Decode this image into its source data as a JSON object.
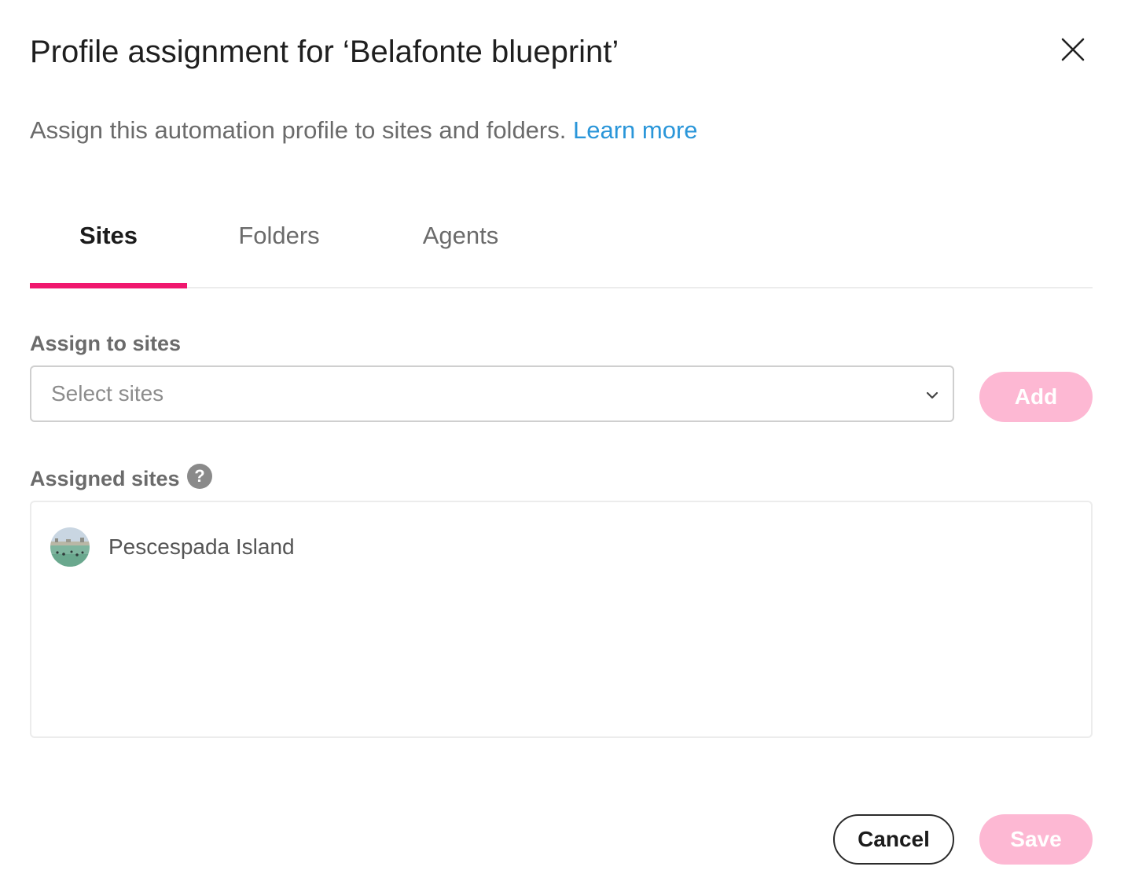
{
  "dialog": {
    "title": "Profile assignment for ‘Belafonte blueprint’",
    "close_icon": "close-icon",
    "subtitle": "Assign this automation profile to sites and folders.",
    "learn_more": "Learn more"
  },
  "tabs": [
    {
      "label": "Sites",
      "active": true
    },
    {
      "label": "Folders",
      "active": false
    },
    {
      "label": "Agents",
      "active": false
    }
  ],
  "assign": {
    "label": "Assign to sites",
    "select_placeholder": "Select sites",
    "chevron_icon": "chevron-down-icon",
    "add_label": "Add"
  },
  "assigned": {
    "label": "Assigned sites",
    "help_icon": "help-icon",
    "help_glyph": "?",
    "sites": [
      {
        "name": "Pescespada Island",
        "avatar_icon": "site-thumbnail"
      }
    ]
  },
  "footer": {
    "cancel_label": "Cancel",
    "save_label": "Save"
  },
  "colors": {
    "accent": "#f0176e",
    "accent_disabled": "#fdb8d3",
    "link": "#2a96d9",
    "muted_text": "#6b6b6b"
  }
}
